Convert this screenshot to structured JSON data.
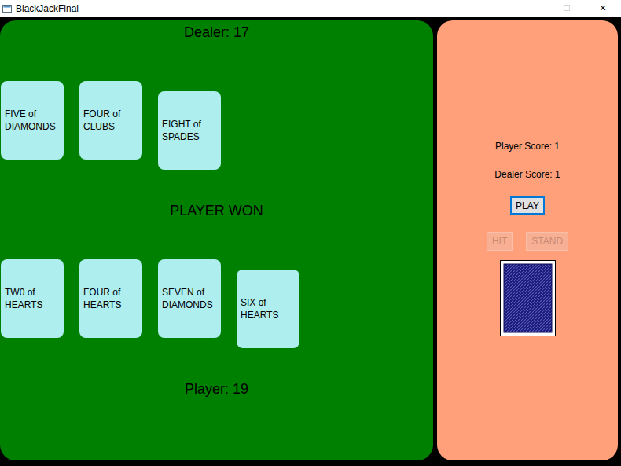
{
  "window": {
    "title": "BlackJackFinal",
    "controls": [
      {
        "glyph": "—",
        "disabled": false
      },
      {
        "glyph": "☐",
        "disabled": true
      },
      {
        "glyph": "✕",
        "disabled": false
      }
    ]
  },
  "table": {
    "dealer": {
      "label": "Dealer: 17",
      "cards": [
        "FIVE of DIAMONDS",
        "FOUR of CLUBS",
        "EIGHT of SPADES"
      ]
    },
    "status": "PLAYER WON",
    "player": {
      "label": "Player: 19",
      "cards": [
        "TW0 of HEARTS",
        "FOUR of HEARTS",
        "SEVEN of DIAMONDS",
        "SIX of HEARTS"
      ]
    }
  },
  "side_panel": {
    "scores": [
      "Player Score: 1",
      "Dealer Score: 1"
    ],
    "play_button": {
      "label": "PLAY",
      "disabled": false,
      "focused": true
    },
    "action_buttons": [
      {
        "label": "HIT",
        "disabled": true
      },
      {
        "label": "STAND",
        "disabled": true
      }
    ]
  }
}
